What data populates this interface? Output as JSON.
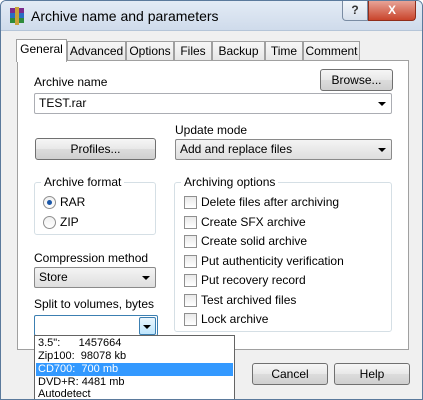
{
  "window": {
    "title": "Archive name and parameters",
    "help_label": "?",
    "close_label": "X"
  },
  "tabs": [
    {
      "label": "General",
      "active": true
    },
    {
      "label": "Advanced"
    },
    {
      "label": "Options"
    },
    {
      "label": "Files"
    },
    {
      "label": "Backup"
    },
    {
      "label": "Time"
    },
    {
      "label": "Comment"
    }
  ],
  "archive_name": {
    "label": "Archive name",
    "browse_label": "Browse...",
    "value": "TEST.rar"
  },
  "profiles_label": "Profiles...",
  "update_mode": {
    "label": "Update mode",
    "value": "Add and replace files"
  },
  "archive_format": {
    "title": "Archive format",
    "options": [
      {
        "label": "RAR",
        "selected": true
      },
      {
        "label": "ZIP",
        "selected": false
      }
    ]
  },
  "archiving_options": {
    "title": "Archiving options",
    "items": [
      {
        "label": "Delete files after archiving",
        "checked": false
      },
      {
        "label": "Create SFX archive",
        "checked": false
      },
      {
        "label": "Create solid archive",
        "checked": false
      },
      {
        "label": "Put authenticity verification",
        "checked": false
      },
      {
        "label": "Put recovery record",
        "checked": false
      },
      {
        "label": "Test archived files",
        "checked": false
      },
      {
        "label": "Lock archive",
        "checked": false
      }
    ]
  },
  "compression": {
    "label": "Compression method",
    "value": "Store"
  },
  "split": {
    "label": "Split to volumes, bytes",
    "value": "",
    "options": [
      {
        "label": "3.5\":      1457664"
      },
      {
        "label": "Zip100:  98078 kb"
      },
      {
        "label": "CD700:  700 mb",
        "selected": true
      },
      {
        "label": "DVD+R: 4481 mb"
      },
      {
        "label": "Autodetect"
      }
    ]
  },
  "buttons": {
    "cancel": "Cancel",
    "help": "Help"
  },
  "colors": {
    "selection": "#3399ff",
    "title_bar": "#cfdbeb"
  }
}
